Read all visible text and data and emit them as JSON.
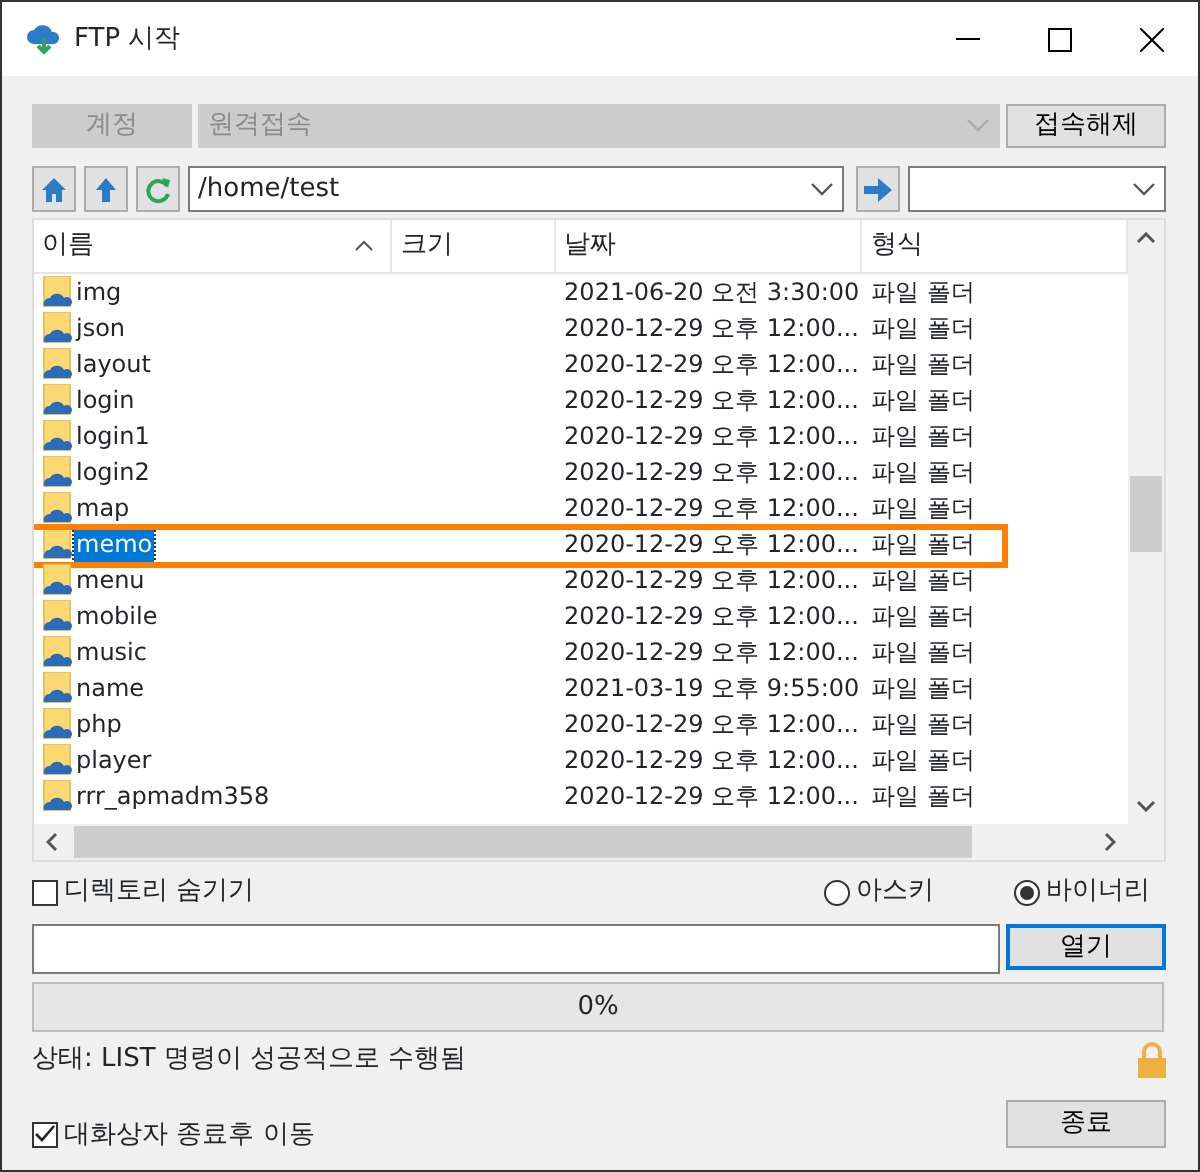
{
  "window": {
    "title": "FTP 시작"
  },
  "account": {
    "button": "계정",
    "disabled": true,
    "connection": "원격접속",
    "disconnect_button": "접속해제"
  },
  "path": {
    "value": "/home/test"
  },
  "table": {
    "columns": [
      {
        "label": "이름",
        "sorted": true
      },
      {
        "label": "크기",
        "sorted": false
      },
      {
        "label": "날짜",
        "sorted": false
      },
      {
        "label": "형식",
        "sorted": false
      }
    ],
    "rows": [
      {
        "name": "img",
        "date": "2021-06-20 오전 3:30:00",
        "type": "파일 폴더",
        "selected": false,
        "highlighted": false
      },
      {
        "name": "json",
        "date": "2020-12-29 오후 12:00...",
        "type": "파일 폴더",
        "selected": false,
        "highlighted": false
      },
      {
        "name": "layout",
        "date": "2020-12-29 오후 12:00...",
        "type": "파일 폴더",
        "selected": false,
        "highlighted": false
      },
      {
        "name": "login",
        "date": "2020-12-29 오후 12:00...",
        "type": "파일 폴더",
        "selected": false,
        "highlighted": false
      },
      {
        "name": "login1",
        "date": "2020-12-29 오후 12:00...",
        "type": "파일 폴더",
        "selected": false,
        "highlighted": false
      },
      {
        "name": "login2",
        "date": "2020-12-29 오후 12:00...",
        "type": "파일 폴더",
        "selected": false,
        "highlighted": false
      },
      {
        "name": "map",
        "date": "2020-12-29 오후 12:00...",
        "type": "파일 폴더",
        "selected": false,
        "highlighted": false
      },
      {
        "name": "memo",
        "date": "2020-12-29 오후 12:00...",
        "type": "파일 폴더",
        "selected": true,
        "highlighted": true
      },
      {
        "name": "menu",
        "date": "2020-12-29 오후 12:00...",
        "type": "파일 폴더",
        "selected": false,
        "highlighted": false
      },
      {
        "name": "mobile",
        "date": "2020-12-29 오후 12:00...",
        "type": "파일 폴더",
        "selected": false,
        "highlighted": false
      },
      {
        "name": "music",
        "date": "2020-12-29 오후 12:00...",
        "type": "파일 폴더",
        "selected": false,
        "highlighted": false
      },
      {
        "name": "name",
        "date": "2021-03-19 오후 9:55:00",
        "type": "파일 폴더",
        "selected": false,
        "highlighted": false
      },
      {
        "name": "php",
        "date": "2020-12-29 오후 12:00...",
        "type": "파일 폴더",
        "selected": false,
        "highlighted": false
      },
      {
        "name": "player",
        "date": "2020-12-29 오후 12:00...",
        "type": "파일 폴더",
        "selected": false,
        "highlighted": false
      },
      {
        "name": "rrr_apmadm358",
        "date": "2020-12-29 오후 12:00...",
        "type": "파일 폴더",
        "selected": false,
        "highlighted": false
      }
    ]
  },
  "options": {
    "hide_dirs": {
      "label": "디렉토리 숨기기",
      "checked": false
    },
    "modes": [
      {
        "label": "아스키",
        "selected": false
      },
      {
        "label": "바이너리",
        "selected": true
      }
    ]
  },
  "file": {
    "open_button": "열기"
  },
  "progress": {
    "level": 0,
    "reading": "0%"
  },
  "status": "상태: LIST 명령이 성공적으로 수행됨",
  "move_after_close": {
    "label": "대화상자 종료후 이동",
    "checked": true
  },
  "close_button": "종료"
}
